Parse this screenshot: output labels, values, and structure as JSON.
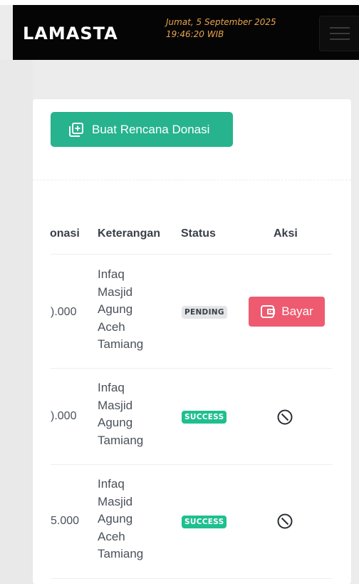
{
  "header": {
    "logo": "LAMASTA",
    "date": "Jumat, 5 September 2025",
    "time": "19:46:20 WIB"
  },
  "actions": {
    "create_label": "Buat Rencana Donasi"
  },
  "table": {
    "columns": [
      "onasi",
      "Keterangan",
      "Status",
      "Aksi"
    ],
    "rows": [
      {
        "amount": ").000",
        "desc": [
          "Infaq",
          "Masjid",
          "Agung",
          "Aceh",
          "Tamiang"
        ],
        "status": "PENDING",
        "action": "Bayar"
      },
      {
        "amount": ").000",
        "desc": [
          "Infaq",
          "Masjid",
          "Agung",
          "Tamiang"
        ],
        "status": "SUCCESS",
        "action": ""
      },
      {
        "amount": "5.000",
        "desc": [
          "Infaq",
          "Masjid",
          "Agung",
          "Aceh",
          "Tamiang"
        ],
        "status": "SUCCESS",
        "action": ""
      }
    ]
  },
  "colors": {
    "header_bg": "#050505",
    "date_text": "#e8a34e",
    "primary": "#26b38e",
    "success": "#1fbf8f",
    "danger": "#ee5a6f",
    "pending_bg": "#e3e5e8"
  },
  "icons": {
    "menu": "hamburger-icon",
    "create": "add-copy-icon",
    "pay": "wallet-icon",
    "disabled": "ban-icon"
  }
}
